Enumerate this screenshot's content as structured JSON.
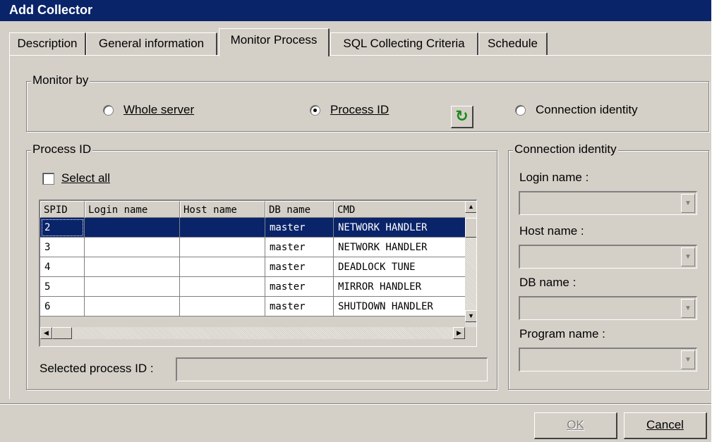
{
  "title": "Add Collector",
  "tabs": [
    {
      "label": "Description"
    },
    {
      "label": "General information"
    },
    {
      "label": "Monitor Process"
    },
    {
      "label": "SQL Collecting Criteria"
    },
    {
      "label": "Schedule"
    }
  ],
  "monitor_by": {
    "label": "Monitor by",
    "options": [
      {
        "label": "Whole server",
        "selected": false
      },
      {
        "label": "Process ID",
        "selected": true
      },
      {
        "label": "Connection identity",
        "selected": false
      }
    ]
  },
  "process_id": {
    "label": "Process ID",
    "select_all": "Select all",
    "columns": [
      "SPID",
      "Login name",
      "Host name",
      "DB name",
      "CMD"
    ],
    "rows": [
      {
        "spid": "2",
        "login": "",
        "host": "",
        "db": "master",
        "cmd": "NETWORK HANDLER"
      },
      {
        "spid": "3",
        "login": "",
        "host": "",
        "db": "master",
        "cmd": "NETWORK HANDLER"
      },
      {
        "spid": "4",
        "login": "",
        "host": "",
        "db": "master",
        "cmd": "DEADLOCK TUNE"
      },
      {
        "spid": "5",
        "login": "",
        "host": "",
        "db": "master",
        "cmd": "MIRROR HANDLER"
      },
      {
        "spid": "6",
        "login": "",
        "host": "",
        "db": "master",
        "cmd": "SHUTDOWN HANDLER"
      }
    ],
    "selected_label": "Selected process ID :",
    "selected_value": ""
  },
  "connection_identity": {
    "label": "Connection identity",
    "login_label": "Login name :",
    "host_label": "Host name :",
    "db_label": "DB name :",
    "program_label": "Program name :"
  },
  "buttons": {
    "ok": "OK",
    "cancel": "Cancel"
  }
}
